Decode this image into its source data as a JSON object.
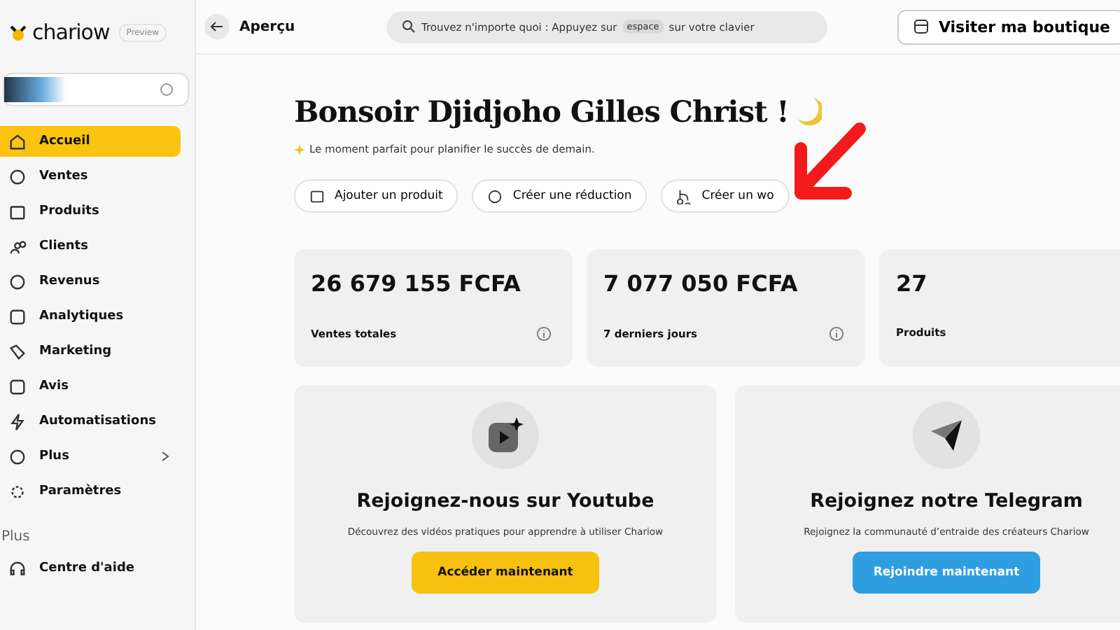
{
  "brand": {
    "name": "chariow",
    "badge": "Preview"
  },
  "sidebar": {
    "items": [
      {
        "label": "Accueil",
        "selected": true,
        "submenu": false
      },
      {
        "label": "Ventes",
        "selected": false,
        "submenu": false
      },
      {
        "label": "Produits",
        "selected": false,
        "submenu": false
      },
      {
        "label": "Clients",
        "selected": false,
        "submenu": false
      },
      {
        "label": "Revenus",
        "selected": false,
        "submenu": false
      },
      {
        "label": "Analytiques",
        "selected": false,
        "submenu": false
      },
      {
        "label": "Marketing",
        "selected": false,
        "submenu": false
      },
      {
        "label": "Avis",
        "selected": false,
        "submenu": false
      },
      {
        "label": "Automatisations",
        "selected": false,
        "submenu": false
      },
      {
        "label": "Plus",
        "selected": false,
        "submenu": true
      },
      {
        "label": "Paramètres",
        "selected": false,
        "submenu": false
      }
    ],
    "section_title": "Plus",
    "help": "Centre d'aide"
  },
  "topbar": {
    "title": "Aperçu",
    "search_before": "Trouvez n'importe quoi : Appuyez sur",
    "search_key": "espace",
    "search_after": "sur votre clavier",
    "visit_button": "Visiter ma boutique"
  },
  "greeting": {
    "title": "Bonsoir Djidjoho Gilles Christ !",
    "subtitle": "Le moment parfait pour planifier le succès de demain."
  },
  "quick_actions": [
    "Ajouter un produit",
    "Créer une réduction",
    "Créer un wo"
  ],
  "stats": [
    {
      "value": "26 679 155 FCFA",
      "label": "Ventes totales",
      "info": true
    },
    {
      "value": "7 077 050 FCFA",
      "label": "7 derniers jours",
      "info": true
    },
    {
      "value": "27",
      "label": "Produits",
      "info": false
    }
  ],
  "community": [
    {
      "kind": "youtube",
      "title": "Rejoignez-nous sur Youtube",
      "text": "Découvrez des vidéos pratiques pour apprendre à utiliser Chariow",
      "button": "Accéder maintenant",
      "color": "#f7c10f"
    },
    {
      "kind": "telegram",
      "title": "Rejoignez notre Telegram",
      "text": "Rejoignez la communauté d’entraide des créateurs Chariow",
      "button": "Rejoindre maintenant",
      "color": "#2f9ee0"
    }
  ]
}
